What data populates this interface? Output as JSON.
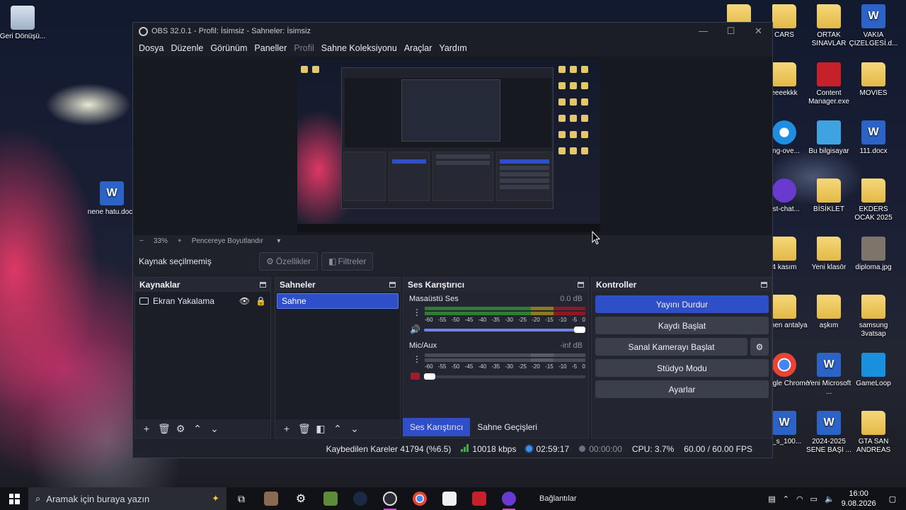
{
  "desktop": {
    "left_icons": [
      {
        "name": "recycle-bin-icon",
        "label": "Geri Dönüşü...",
        "kind": "recycle"
      },
      {
        "name": "word-doc-icon",
        "label": "nene hatu.docx",
        "kind": "word"
      }
    ],
    "right_icons": [
      {
        "label": "",
        "kind": "folder"
      },
      {
        "label": "CARS",
        "kind": "folder"
      },
      {
        "label": "ORTAK SINAVLAR",
        "kind": "folder"
      },
      {
        "label": "VAKIA ÇIZELGESİ.d...",
        "kind": "word"
      },
      {
        "label": "eeeekkk",
        "kind": "folder"
      },
      {
        "label": "Content Manager.exe",
        "kind": "exe"
      },
      {
        "label": "MOVIES",
        "kind": "folder"
      },
      {
        "label": "ting-ove...",
        "kind": "ie"
      },
      {
        "label": "Bu bilgisayar",
        "kind": "pc"
      },
      {
        "label": "111.docx",
        "kind": "word"
      },
      {
        "label": "ost-chat...",
        "kind": "ghost"
      },
      {
        "label": "BİSİKLET",
        "kind": "folder"
      },
      {
        "label": "EKDERS OCAK 2025",
        "kind": "folder"
      },
      {
        "label": "4 kasım",
        "kind": "folder"
      },
      {
        "label": "Yeni klasör",
        "kind": "folder"
      },
      {
        "label": "diploma.jpg",
        "kind": "img"
      },
      {
        "label": "eymen antalya",
        "kind": "folder"
      },
      {
        "label": "aşkım",
        "kind": "folder"
      },
      {
        "label": "samsung 3vatsap",
        "kind": "folder"
      },
      {
        "label": "Google Chrome",
        "kind": "chrome"
      },
      {
        "label": "Yeni Microsoft ...",
        "kind": "word"
      },
      {
        "label": "GameLoop",
        "kind": "game"
      },
      {
        "label": "w_s_100...",
        "kind": "word"
      },
      {
        "label": "2024-2025 SENE BAŞI ...",
        "kind": "word"
      },
      {
        "label": "GTA SAN ANDREAS",
        "kind": "folder"
      }
    ]
  },
  "obs": {
    "title": "OBS 32.0.1 - Profil: İsimsiz - Sahneler: İsimsiz",
    "window_controls": [
      "—",
      "☐",
      "✕"
    ],
    "menu": [
      {
        "label": "Dosya",
        "disabled": false
      },
      {
        "label": "Düzenle",
        "disabled": false
      },
      {
        "label": "Görünüm",
        "disabled": false
      },
      {
        "label": "Paneller",
        "disabled": false
      },
      {
        "label": "Profil",
        "disabled": true
      },
      {
        "label": "Sahne Koleksiyonu",
        "disabled": false
      },
      {
        "label": "Araçlar",
        "disabled": false
      },
      {
        "label": "Yardım",
        "disabled": false
      }
    ],
    "zoom": {
      "minus": "−",
      "value": "33%",
      "plus": "+",
      "fit": "Pencereye Boyutlandır"
    },
    "source_bar": {
      "status": "Kaynak seçilmemiş",
      "properties": "Özellikler",
      "filters": "Filtreler"
    },
    "docks": {
      "sources": {
        "title": "Kaynaklar",
        "items": [
          {
            "label": "Ekran Yakalama"
          }
        ]
      },
      "scenes": {
        "title": "Sahneler",
        "items": [
          {
            "label": "Sahne"
          }
        ]
      },
      "mixer": {
        "title": "Ses Karıştırıcı",
        "channels": [
          {
            "name": "Masaüstü Ses",
            "db": "0.0 dB",
            "volume": 1.0,
            "muted": false
          },
          {
            "name": "Mic/Aux",
            "db": "-inf dB",
            "volume": 0.0,
            "muted": true
          }
        ],
        "scale": [
          "-60",
          "-55",
          "-50",
          "-45",
          "-40",
          "-35",
          "-30",
          "-25",
          "-20",
          "-15",
          "-10",
          "-5",
          "0"
        ]
      },
      "controls": {
        "title": "Kontroller",
        "buttons": {
          "stream": "Yayını Durdur",
          "record": "Kaydı Başlat",
          "virtualcam": "Sanal Kamerayı Başlat",
          "studio": "Stüdyo Modu",
          "settings": "Ayarlar"
        }
      }
    },
    "bottom_tabs": [
      "Ses Karıştırıcı",
      "Sahne Geçişleri"
    ],
    "status": {
      "dropped": "Kaybedilen Kareler 41794 (%6.5)",
      "bitrate": "10018 kbps",
      "stream_time": "02:59:17",
      "rec_time": "00:00:00",
      "cpu": "CPU: 3.7%",
      "fps": "60.00 / 60.00 FPS"
    }
  },
  "taskbar": {
    "search_placeholder": "Aramak için buraya yazın",
    "label_text": "Bağlantılar",
    "time": "16:00",
    "date": "9.08.2026"
  }
}
